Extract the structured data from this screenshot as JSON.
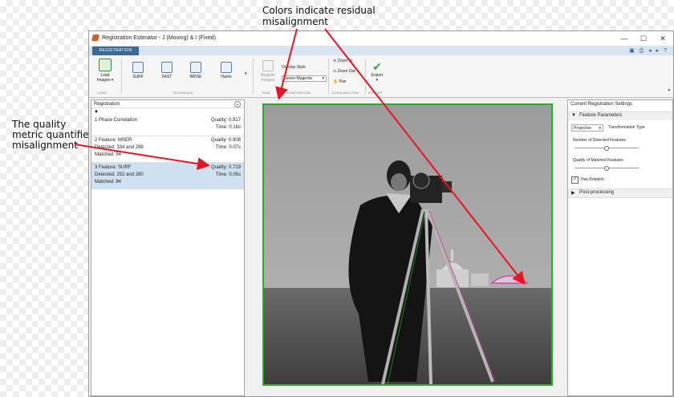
{
  "annotations": {
    "top_line1": "Colors indicate residual",
    "top_line2": "misalignment",
    "left_line1": "The quality",
    "left_line2": "metric quantifies",
    "left_line3": "misalignment"
  },
  "window": {
    "title": "Registration Estimator - J (Moving)  & I (Fixed)",
    "min": "—",
    "max": "☐",
    "close": "✕"
  },
  "tab": {
    "label": "REGISTRATION"
  },
  "toolbar_icons": "▣ ⎙ ◂ ▸ ?",
  "ribbon": {
    "load": {
      "label1": "Load",
      "label2": "Images ▾"
    },
    "surf": "SURF",
    "fast": "FAST",
    "brisk": "BRISK",
    "harris": "Harris",
    "register": {
      "label1": "Register",
      "label2": "Images"
    },
    "overlay_label": "Overlay Style",
    "overlay_value": "Green-Magenta",
    "zoom_in": "Zoom In",
    "zoom_out": "Zoom Out",
    "pan": "Pan",
    "export": "Export",
    "groups": {
      "load": "LOAD",
      "technique": "TECHNIQUE",
      "run": "RUN",
      "comparison": "COMPARISON",
      "zoom": "ZOOM AND PAN",
      "export": "EXPORT"
    }
  },
  "left_panel": {
    "title": "Registration",
    "results": [
      {
        "name": "1  Phase Correlation",
        "quality": "Quality:  0.917",
        "time": "Time:  0.16s",
        "detected": "",
        "matched": ""
      },
      {
        "name": "2  Feature: MSER",
        "quality": "Quality:  0.908",
        "time": "Time:  0.07s",
        "detected": "Detected: 334 and 298",
        "matched": "Matched: 54"
      },
      {
        "name": "3  Feature: SURF",
        "quality": "Quality:  0.729",
        "time": "Time:  0.05s",
        "detected": "Detected: 252 and 280",
        "matched": "Matched: 84"
      }
    ]
  },
  "right_panel": {
    "title": "Current Registration Settings",
    "feature_params": "Feature Parameters",
    "transform_value": "Projective",
    "transform_label": "Transformation Type",
    "num_detected_label": "Number of Detected Features",
    "num_detected_level": 0.5,
    "quality_label": "Quality of Matched Features",
    "quality_level": 0.5,
    "rotation_label": "Has Rotation",
    "rotation_checked": true,
    "post_processing": "Post-processing"
  },
  "colors": {
    "accent": "#3d6a96",
    "selection": "#cfe1f0",
    "arrow": "#e8141f",
    "overlay_green": "#26b02a",
    "overlay_magenta": "#c4249c"
  }
}
